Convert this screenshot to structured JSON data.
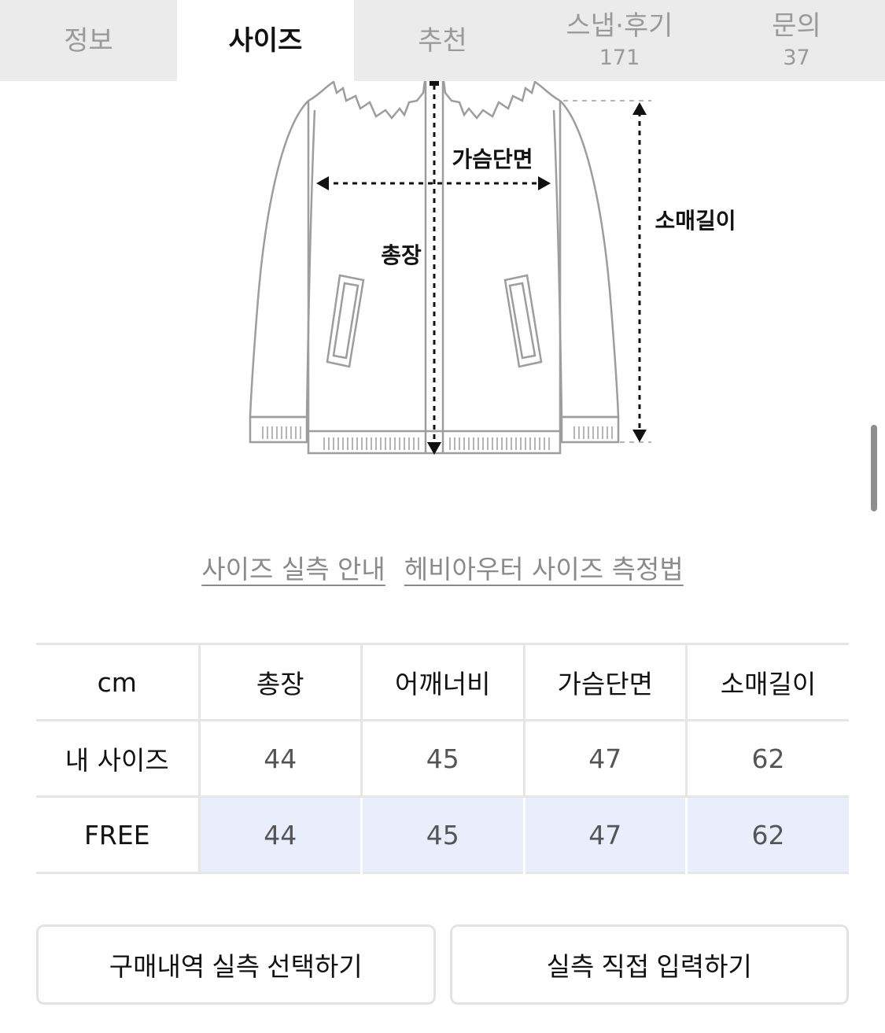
{
  "tabs": [
    {
      "label": "정보",
      "count": ""
    },
    {
      "label": "사이즈",
      "count": ""
    },
    {
      "label": "추천",
      "count": ""
    },
    {
      "label": "스냅·후기",
      "count": "171"
    },
    {
      "label": "문의",
      "count": "37"
    }
  ],
  "active_tab": "사이즈",
  "diagram": {
    "chest_label": "가슴단면",
    "sleeve_label": "소매길이",
    "length_label": "총장"
  },
  "guide_links": {
    "size_guide": "사이즈 실측 안내",
    "measure_method": "헤비아우터 사이즈 측정법"
  },
  "size_table": {
    "unit": "cm",
    "columns": [
      "총장",
      "어깨너비",
      "가슴단면",
      "소매길이"
    ],
    "rows": [
      {
        "label": "내 사이즈",
        "values": [
          "44",
          "45",
          "47",
          "62"
        ]
      },
      {
        "label": "FREE",
        "values": [
          "44",
          "45",
          "47",
          "62"
        ]
      }
    ],
    "highlight_color": "#e8eefc"
  },
  "buttons": {
    "purchase_history": "구매내역 실측 선택하기",
    "direct_input": "실측 직접 입력하기"
  }
}
